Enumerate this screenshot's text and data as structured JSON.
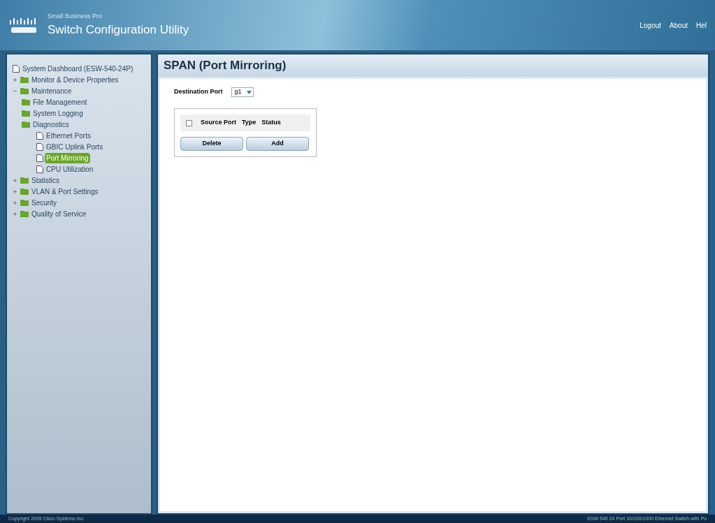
{
  "header": {
    "subtitle": "Small Business Pro",
    "title": "Switch Configuration Utility",
    "links": [
      "Logout",
      "About",
      "Hel"
    ]
  },
  "sidebar": {
    "items": [
      {
        "label": "System Dashboard (ESW-540-24P)",
        "kind": "page",
        "selected": false
      },
      {
        "label": "Monitor & Device Properties",
        "kind": "folder",
        "expanded": false,
        "selected": false
      },
      {
        "label": "Maintenance",
        "kind": "folder",
        "expanded": true,
        "selected": false,
        "children": [
          {
            "label": "File Management",
            "kind": "folder",
            "selected": false
          },
          {
            "label": "System Logging",
            "kind": "folder",
            "selected": false
          },
          {
            "label": "Diagnostics",
            "kind": "folder",
            "selected": false,
            "children": [
              {
                "label": "Ethernet Ports",
                "kind": "page",
                "selected": false
              },
              {
                "label": "GBIC Uplink Ports",
                "kind": "page",
                "selected": false
              },
              {
                "label": "Port Mirroring",
                "kind": "page",
                "selected": true
              },
              {
                "label": "CPU Utilization",
                "kind": "page",
                "selected": false
              }
            ]
          }
        ]
      },
      {
        "label": "Statistics",
        "kind": "folder",
        "expanded": false,
        "selected": false
      },
      {
        "label": "VLAN & Port Settings",
        "kind": "folder",
        "expanded": false,
        "selected": false
      },
      {
        "label": "Security",
        "kind": "folder",
        "expanded": false,
        "selected": false
      },
      {
        "label": "Quality of Service",
        "kind": "folder",
        "expanded": false,
        "selected": false
      }
    ]
  },
  "page": {
    "title": "SPAN (Port Mirroring)",
    "destination_port": {
      "label": "Destination Port",
      "value": "g1"
    },
    "table": {
      "select_all": {
        "checked": false
      },
      "columns": [
        "Source Port",
        "Type",
        "Status"
      ]
    },
    "buttons": [
      "Delete",
      "Add"
    ]
  },
  "footer": {
    "copyright": "Copyright 2009 Cisco Systems Inc.",
    "device": "ESW 540 24 Port 10/100/1000 Ethernet Switch with Po"
  }
}
